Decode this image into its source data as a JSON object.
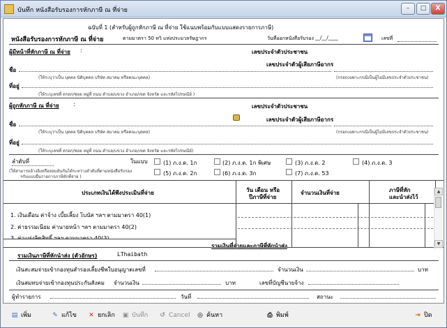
{
  "window": {
    "title": "บันทึก หนังสือรับรองการหักภาษี ณ ที่จ่าย",
    "min_label": "–",
    "max_label": "□",
    "close_label": "X"
  },
  "header": {
    "copy_note": "ฉบับที่ 1 (สำหรับผู้ถูกหักภาษี ณ ที่จ่าย ใช้แนบพร้อมกับแบบแสดงรายการภาษี)",
    "title": "หนังสือรับรองการหักภาษี ณ ที่จ่าย",
    "subtitle": "ตามมาตรา 50 ทวิ แห่งประมวลรัษฎากร",
    "issue_date_label": "วันที่ออกหนังสือรับรอง",
    "issue_date_value": "__/__/____",
    "number_label": "เลขที่"
  },
  "payer": {
    "section_label": "ผู้มีหน้าที่หักภาษี ณ ที่จ่าย",
    "taxid_label": "เลขประจำตัวประชาชน",
    "taxno_label": "เลขประจำตัวผู้เสียภาษีอากร",
    "name_label": "ชื่อ",
    "name_hint": "(ให้ระบุว่าเป็น บุคคล นิติบุคคล บริษัท สมาคม หรือคณะบุคคล)",
    "taxno_hint": "(กรอกเฉพาะกรณีเป็นผู้ไม่มีเลขประจำตัวประชาชน)",
    "address_label": "ที่อยู่",
    "address_hint": "(ให้ระบุเลขที่ ตรอก/ซอย หมู่ที่ ถนน ตำบล/แขวง อำเภอ/เขต จังหวัด และรหัสไปรษณีย์ )"
  },
  "payee": {
    "section_label": "ผู้ถูกหักภาษี ณ ที่จ่าย",
    "taxid_label": "เลขประจำตัวประชาชน",
    "taxno_label": "เลขประจำตัวผู้เสียภาษีอากร",
    "name_label": "ชื่อ",
    "name_hint": "(ให้ระบุว่าเป็น บุคคล นิติบุคคล บริษัท สมาคม หรือคณะบุคคล)",
    "taxno_hint": "(กรอกเฉพาะกรณีเป็นผู้ไม่มีเลขประจำตัวประชาชน)",
    "address_label": "ที่อยู่",
    "address_hint": "(ให้ระบุเลขที่ ตรอก/ซอย หมู่ที่ ถนน ตำบล/แขวง อำเภอ/เขต จังหวัด และรหัสไปรษณีย์)"
  },
  "form_type": {
    "order_label": "ลำดับที่",
    "attach_label": "ในแบบ",
    "note_line1": "(ให้สามารถอ้างอิงหรือสอบยันกันได้ระหว่างลำดับที่ตามหนังสือรับรอง",
    "note_line2": "ฯกับแบบยื่นรายการภาษีหักที่จ่าย )",
    "options": [
      {
        "label": "(1) ภ.ง.ด. 1ก",
        "checked": false
      },
      {
        "label": "(2) ภ.ง.ด. 1ก พิเศษ",
        "checked": false
      },
      {
        "label": "(3) ภ.ง.ด. 2",
        "checked": false
      },
      {
        "label": "(4) ภ.ง.ด. 3",
        "checked": false
      },
      {
        "label": "(5) ภ.ง.ด. 2ก",
        "checked": false
      },
      {
        "label": "(6) ภ.ง.ด. 3ก",
        "checked": false
      },
      {
        "label": "(7) ภ.ง.ด. 53",
        "checked": false
      }
    ]
  },
  "income_table": {
    "headers": {
      "type": "ประเภทเงินได้พึงประเมินที่จ่าย",
      "date_line1": "วัน เดือน หรือ",
      "date_line2": "ปีภาษีที่จ่าย",
      "amount": "จำนวนเงินที่จ่าย",
      "tax_line1": "ภาษีที่หัก",
      "tax_line2": "และนำส่งไว้"
    },
    "rows": [
      "1. เงินเดือน ค่าจ้าง เบี้ยเลี้ยง โบนัส ฯลฯ ตามมาตรา 40(1)",
      "2. ค่าธรรมเนียม ค่านายหน้า ฯลฯ ตามมาตรา 40(2)",
      "3. ค่าแห่งลิขสิทธิ์ ฯลฯ ตามมาตรา 40(3)"
    ],
    "total_label": "รวมเงินที่จ่ายและภาษีที่หักนำส่ง"
  },
  "totals": {
    "text_label": "รวมเงินภาษีที่หักนำส่ง (ตัวอักษร)",
    "text_value": "LThaibath"
  },
  "funds": {
    "pension_label": "เงินสะสมจ่ายเข้ากองทุนสำรองเลี้ยงชีพใบอนุญาตเลขที่",
    "amount_label": "จำนวนเงิน",
    "baht_label": "บาท",
    "ss_label": "เงินสมทบจ่ายเข้ากองทุนประกันสังคม",
    "ss_amount_label": "จำนวนเงิน",
    "ss_baht_label": "บาท",
    "employer_label": "เลขที่บัญชีนายจ้าง"
  },
  "signoff": {
    "preparer_label": "ผู้ทำรายการ",
    "date_label": "วันที่",
    "status_label": "สถานะ"
  },
  "toolbar": {
    "add": "เพิ่ม",
    "edit": "แก้ไข",
    "cancel_doc": "ยกเลิก",
    "save": "บันทึก",
    "cancel": "Cancel",
    "search": "ค้นหา",
    "print": "พิมพ์",
    "close": "ปิด"
  },
  "colors": {
    "window_border": "#6d7f99",
    "title_gradient_top": "#dfe8f4",
    "close_red": "#c5453a",
    "accent_calendar": "#7a8fd8"
  }
}
